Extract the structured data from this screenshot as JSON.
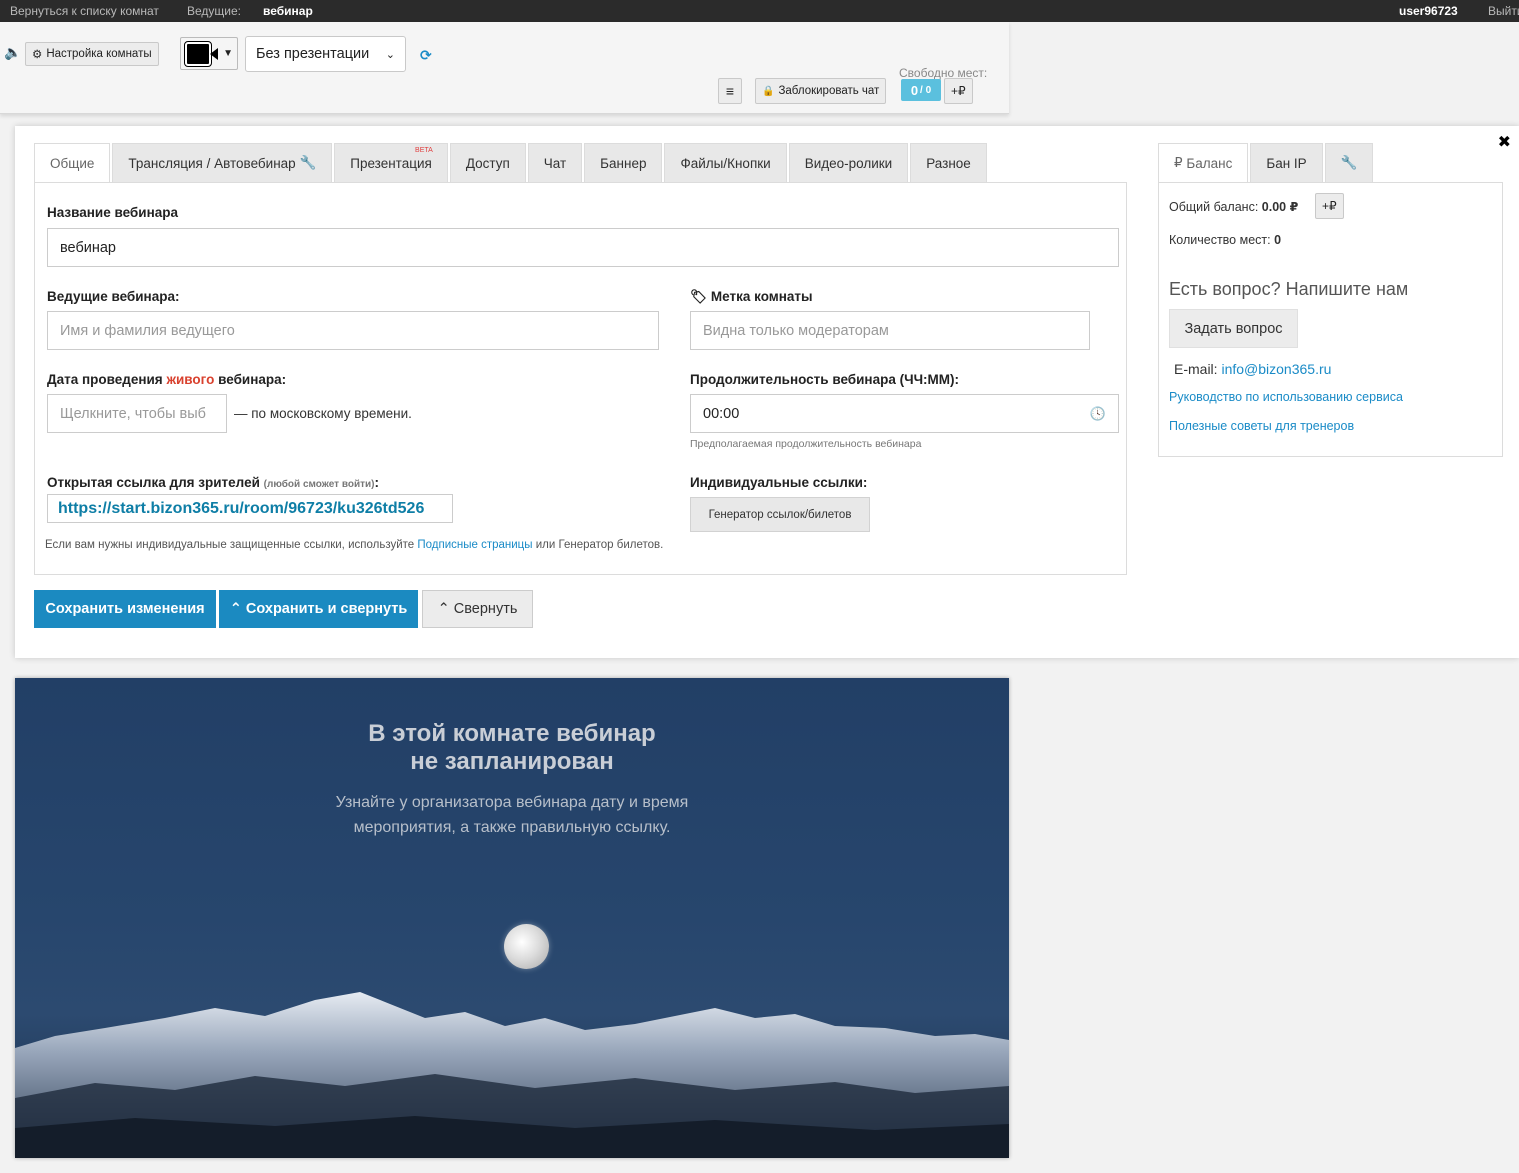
{
  "topbar": {
    "back": "Вернуться к списку комнат",
    "hosts_label": "Ведущие:",
    "room_name": "вебинар",
    "username": "user96723",
    "logout": "Выйти"
  },
  "toolbar": {
    "room_settings": "Настройка комнаты",
    "presentation_value": "Без презентации",
    "lock_chat": "Заблокировать чат",
    "free_seats_label": "Свободно мест:",
    "seats_free": "0",
    "seats_total": "/ 0",
    "add_rub": "+₽"
  },
  "tabs": [
    {
      "label": "Общие",
      "active": true
    },
    {
      "label": "Трансляция / Автовебинар",
      "active": false
    },
    {
      "label": "Презентация",
      "active": false,
      "badge": "BETA"
    },
    {
      "label": "Доступ",
      "active": false
    },
    {
      "label": "Чат",
      "active": false
    },
    {
      "label": "Баннер",
      "active": false
    },
    {
      "label": "Файлы/Кнопки",
      "active": false
    },
    {
      "label": "Видео-ролики",
      "active": false
    },
    {
      "label": "Разное",
      "active": false
    }
  ],
  "form": {
    "title_label": "Название вебинара",
    "title_value": "вебинар",
    "hosts_label": "Ведущие вебинара:",
    "hosts_placeholder": "Имя и фамилия ведущего",
    "tag_label": "Метка комнаты",
    "tag_placeholder": "Видна только модераторам",
    "date_label_pre": "Дата проведения ",
    "date_label_red": "живого",
    "date_label_post": " вебинара:",
    "date_placeholder": "Щелкните, чтобы выб",
    "date_suffix": "— по московскому времени.",
    "duration_label": "Продолжительность вебинара (ЧЧ:ММ):",
    "duration_value": "00:00",
    "duration_hint": "Предполагаемая продолжительность вебинара",
    "open_link_label": "Открытая ссылка для зрителей",
    "open_link_note": "(любой сможет войти)",
    "open_link_colon": ":",
    "open_link_url": "https://start.bizon365.ru/room/96723/ku326td526",
    "individual_label": "Индивидуальные ссылки:",
    "generator_button": "Генератор ссылок/билетов",
    "note_pre": "Если вам нужны индивидуальные защищенные ссылки, используйте ",
    "note_link": "Подписные страницы",
    "note_post": " или Генератор билетов."
  },
  "actions": {
    "save": "Сохранить изменения",
    "save_collapse": "Сохранить и свернуть",
    "collapse": "Свернуть"
  },
  "right_panel": {
    "tabs": [
      "Баланс",
      "Бан IP"
    ],
    "balance_label": "Общий баланс:",
    "balance_value": "0.00 ₽",
    "add_rub": "+₽",
    "seats_label": "Количество мест:",
    "seats_value": "0",
    "question": "Есть вопрос? Напишите нам",
    "ask_button": "Задать вопрос",
    "email_label": "E-mail:",
    "email": "info@bizon365.ru",
    "guide_link": "Руководство по использованию сервиса",
    "tips_link": "Полезные советы для тренеров"
  },
  "video": {
    "title_line1": "В этой комнате вебинар",
    "title_line2": "не запланирован",
    "sub_line1": "Узнайте у организатора вебинара дату и время",
    "sub_line2": "мероприятия, а также правильную ссылку."
  }
}
